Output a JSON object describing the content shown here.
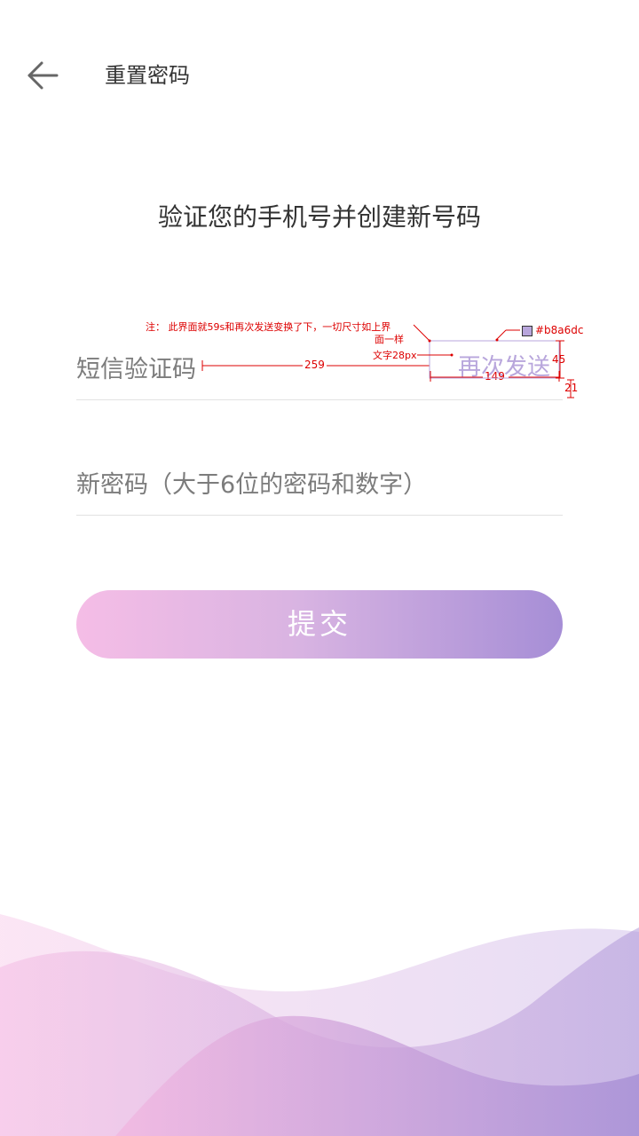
{
  "header": {
    "back_icon": "arrow-left-icon",
    "title": "重置密码"
  },
  "subtitle": "验证您的手机号并创建新号码",
  "form": {
    "sms_code": {
      "value": "",
      "placeholder": "短信验证码",
      "resend_label": "再次发送"
    },
    "new_password": {
      "value": "",
      "placeholder": "新密码（大于6位的密码和数字）"
    },
    "submit_label": "提交"
  },
  "annotations": {
    "note_line1": "注：   此界面就59s和再次发送变换了下，一切尺寸如上界",
    "note_line2": "面一样",
    "font_note": "文字28px",
    "color_note": "#b8a6dc",
    "dim_259": "259",
    "dim_149": "149",
    "dim_45": "45",
    "dim_21": "21"
  },
  "colors": {
    "accent": "#b8a6dc",
    "button_start": "#f5bde6",
    "button_end": "#a68ed6"
  }
}
